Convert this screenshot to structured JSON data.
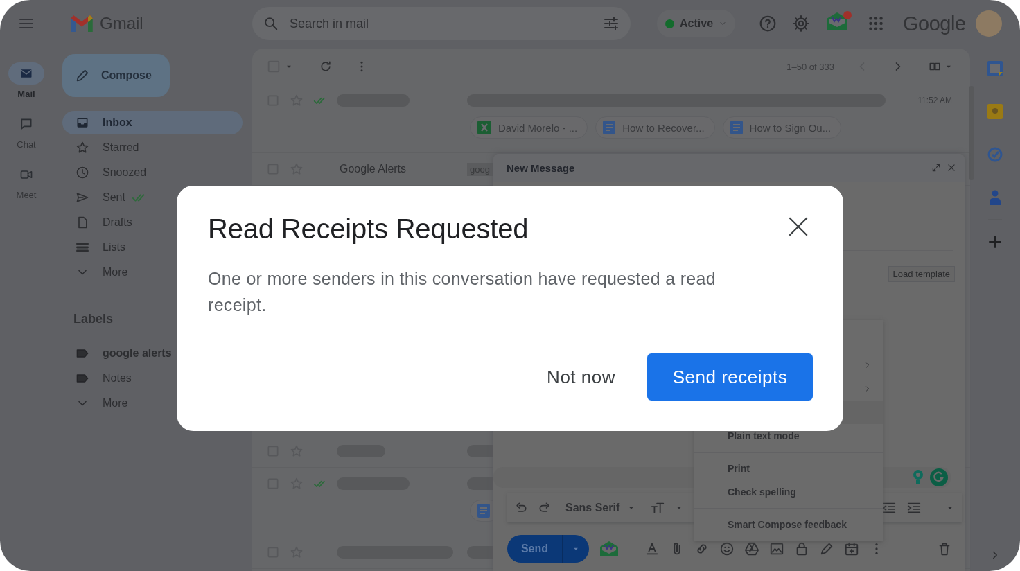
{
  "header": {
    "product": "Gmail",
    "search_placeholder": "Search in mail",
    "status": "Active",
    "brand": "Google"
  },
  "rail": [
    {
      "label": "Mail",
      "kind": "mail",
      "selected": true
    },
    {
      "label": "Chat",
      "kind": "chat",
      "selected": false
    },
    {
      "label": "Meet",
      "kind": "meet",
      "selected": false
    }
  ],
  "compose_button": "Compose",
  "nav": [
    {
      "label": "Inbox",
      "kind": "inbox",
      "selected": true,
      "tick": false
    },
    {
      "label": "Starred",
      "kind": "star",
      "selected": false,
      "tick": false
    },
    {
      "label": "Snoozed",
      "kind": "clock",
      "selected": false,
      "tick": false
    },
    {
      "label": "Sent",
      "kind": "send",
      "selected": false,
      "tick": true
    },
    {
      "label": "Drafts",
      "kind": "file",
      "selected": false,
      "tick": false
    },
    {
      "label": "Lists",
      "kind": "list",
      "selected": false,
      "tick": false
    },
    {
      "label": "More",
      "kind": "chevron",
      "selected": false,
      "tick": false
    }
  ],
  "labels_heading": "Labels",
  "labels": [
    {
      "kind": "label",
      "name": "google alerts",
      "unread": true
    },
    {
      "kind": "label",
      "name": "Notes",
      "unread": false
    },
    {
      "kind": "more",
      "name": "More",
      "unread": false
    }
  ],
  "list_toolbar": {
    "select_all_checked": false,
    "range": "1–50 of 333"
  },
  "emails": [
    {
      "checked": false,
      "tick": true,
      "time": "11:52 AM",
      "attachments": [
        {
          "kind": "sheet",
          "name": "David Morelo - ..."
        },
        {
          "kind": "doc",
          "name": "How to Recover..."
        },
        {
          "kind": "doc",
          "name": "How to Sign Ou..."
        }
      ]
    },
    {
      "checked": false,
      "tick": false,
      "sender": "Google Alerts",
      "tag": "goog"
    },
    {
      "checked": false,
      "tick": false
    },
    {
      "checked": false,
      "tick": true,
      "attachments": [
        {
          "kind": "doc"
        }
      ]
    },
    {
      "checked": false,
      "tick": false
    }
  ],
  "compose": {
    "title": "New Message",
    "load_template": "Load template",
    "font": "Sans Serif",
    "send": "Send",
    "menu": [
      {
        "kind": "blank"
      },
      {
        "kind": "submenu"
      },
      {
        "kind": "submenu"
      },
      {
        "kind": "hover"
      },
      {
        "kind": "item",
        "label": "Plain text mode"
      },
      {
        "kind": "divider"
      },
      {
        "kind": "item",
        "label": "Print"
      },
      {
        "kind": "item",
        "label": "Check spelling"
      },
      {
        "kind": "divider"
      },
      {
        "kind": "item",
        "label": "Smart Compose feedback"
      }
    ]
  },
  "dialog": {
    "title": "Read Receipts Requested",
    "body": "One or more senders in this conversation have requested a read receipt.",
    "secondary": "Not now",
    "primary": "Send receipts"
  }
}
